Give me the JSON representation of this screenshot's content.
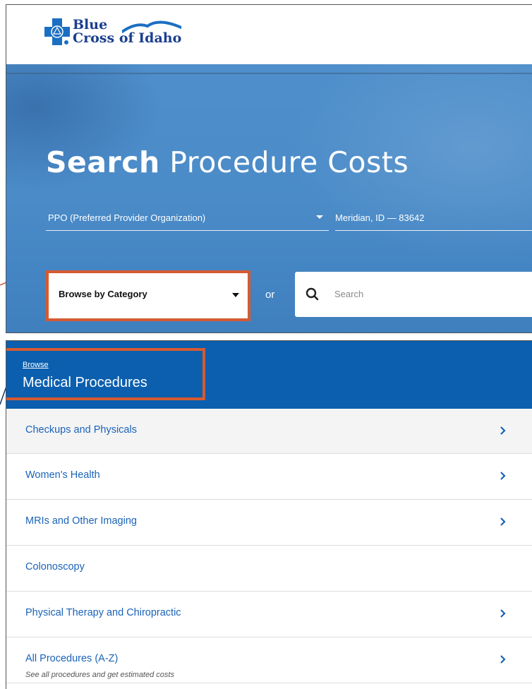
{
  "logo": {
    "line1": "Blue",
    "line2": "Cross of Idaho"
  },
  "hero": {
    "title_bold": "Search",
    "title_rest": " Procedure Costs",
    "plan": "PPO (Preferred Provider Organization)",
    "location": "Meridian, ID — 83642",
    "browse_label": "Browse by Category",
    "or": "or",
    "search_placeholder": "Search"
  },
  "browse": {
    "crumb": "Browse",
    "title": "Medical Procedures",
    "items": [
      {
        "label": "Checkups and Physicals",
        "chevron": true
      },
      {
        "label": "Women's Health",
        "chevron": true
      },
      {
        "label": "MRIs and Other Imaging",
        "chevron": true
      },
      {
        "label": "Colonoscopy",
        "chevron": false
      },
      {
        "label": "Physical Therapy and Chiropractic",
        "chevron": true
      },
      {
        "label": "All Procedures (A-Z)",
        "sub": "See all procedures and get estimated costs",
        "chevron": true
      }
    ]
  },
  "colors": {
    "brand_blue": "#0b5fae",
    "link_blue": "#1a63b8",
    "callout_orange": "#d65a31",
    "hero_blue": "#4a8bc8"
  }
}
